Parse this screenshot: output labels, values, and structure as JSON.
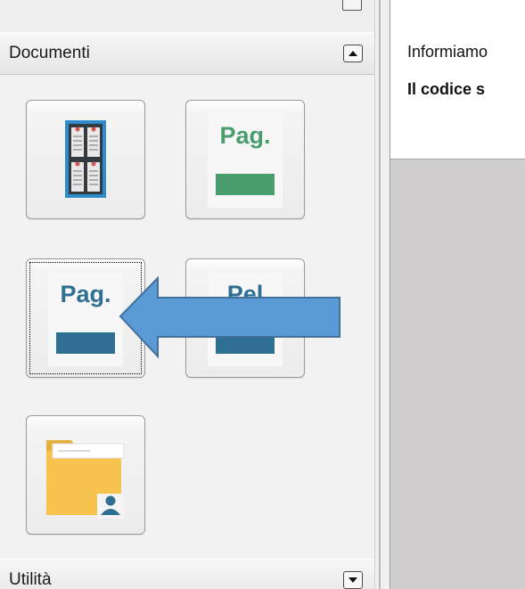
{
  "documents_section": {
    "title": "Documenti",
    "collapse_icon": "collapse-up-icon",
    "tiles": [
      {
        "icon": "bacheca-board-icon"
      },
      {
        "label": "Pag.",
        "color": "#4a9e6e"
      },
      {
        "label": "Pag.",
        "color": "#2f6f93"
      },
      {
        "label": "Pel",
        "color": "#2f6f93"
      },
      {
        "icon": "folder-user-icon"
      }
    ]
  },
  "utility_section": {
    "title": "Utilità",
    "expand_icon": "expand-down-icon"
  },
  "info_panel": {
    "line1": "Informiamo",
    "line2": "Il codice s"
  },
  "colors": {
    "arrow_fill": "#5b9bd5",
    "arrow_stroke": "#41719c",
    "board_frame": "#2d8cc9",
    "folder": "#f8c24f",
    "user_badge": "#2f6f93"
  }
}
